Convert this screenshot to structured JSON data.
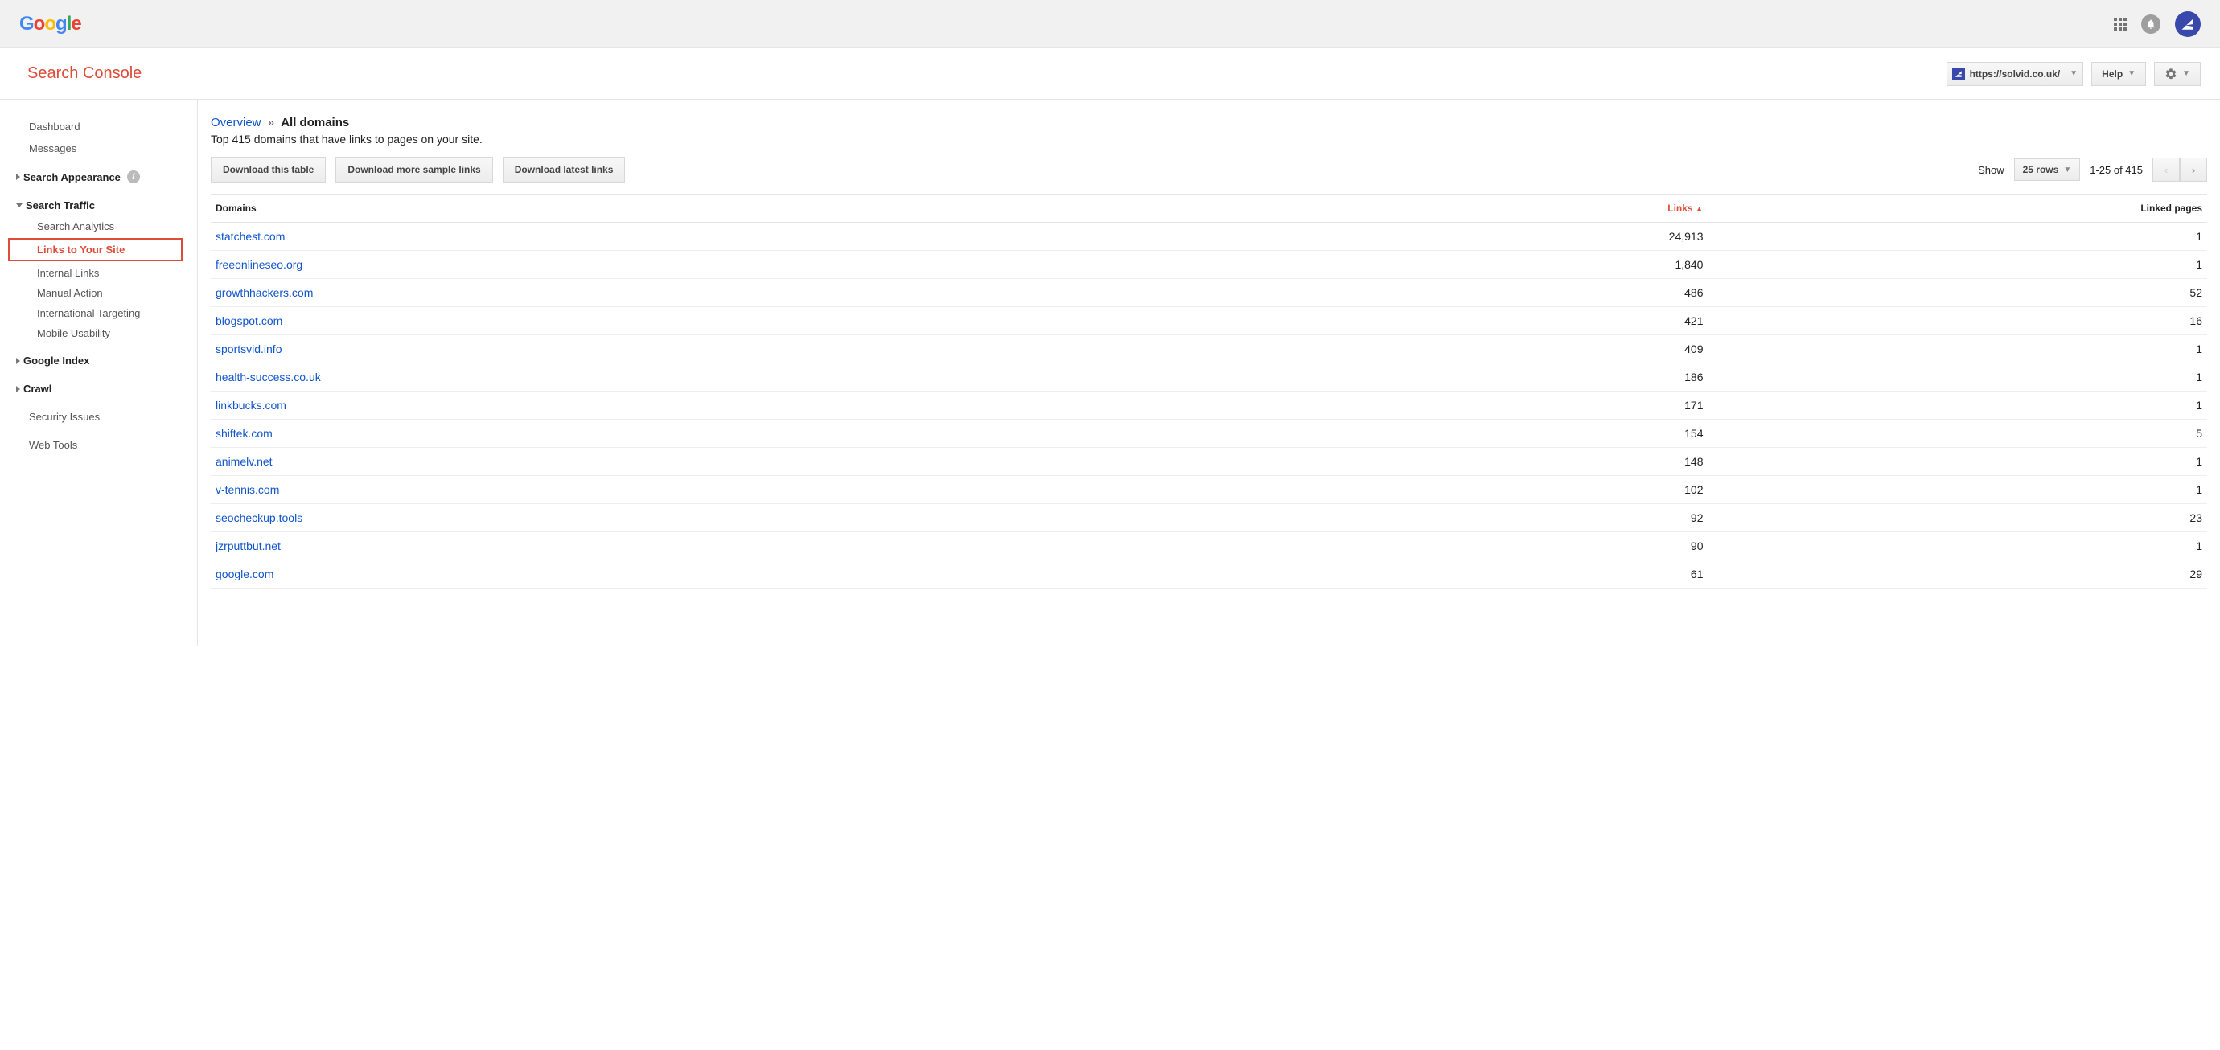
{
  "header": {
    "logo_text": "Google"
  },
  "subheader": {
    "title": "Search Console",
    "site_url": "https://solvid.co.uk/",
    "help_label": "Help"
  },
  "sidebar": {
    "dashboard": "Dashboard",
    "messages": "Messages",
    "search_appearance": "Search Appearance",
    "search_traffic": "Search Traffic",
    "children": {
      "analytics": "Search Analytics",
      "links_to_site": "Links to Your Site",
      "internal": "Internal Links",
      "manual": "Manual Action",
      "intl": "International Targeting",
      "mobile": "Mobile Usability"
    },
    "google_index": "Google Index",
    "crawl": "Crawl",
    "security": "Security Issues",
    "webtools": "Web Tools"
  },
  "main": {
    "bc_overview": "Overview",
    "bc_sep": "»",
    "bc_current": "All domains",
    "subtitle": "Top 415 domains that have links to pages on your site.",
    "dl_table": "Download this table",
    "dl_more": "Download more sample links",
    "dl_latest": "Download latest links",
    "show_label": "Show",
    "rows_selected": "25 rows",
    "range_text": "1-25 of 415",
    "th_domain": "Domains",
    "th_links": "Links",
    "th_pages": "Linked pages",
    "rows": [
      {
        "domain": "statchest.com",
        "links": "24,913",
        "pages": "1"
      },
      {
        "domain": "freeonlineseo.org",
        "links": "1,840",
        "pages": "1"
      },
      {
        "domain": "growthhackers.com",
        "links": "486",
        "pages": "52"
      },
      {
        "domain": "blogspot.com",
        "links": "421",
        "pages": "16"
      },
      {
        "domain": "sportsvid.info",
        "links": "409",
        "pages": "1"
      },
      {
        "domain": "health-success.co.uk",
        "links": "186",
        "pages": "1"
      },
      {
        "domain": "linkbucks.com",
        "links": "171",
        "pages": "1"
      },
      {
        "domain": "shiftek.com",
        "links": "154",
        "pages": "5"
      },
      {
        "domain": "animelv.net",
        "links": "148",
        "pages": "1"
      },
      {
        "domain": "v-tennis.com",
        "links": "102",
        "pages": "1"
      },
      {
        "domain": "seocheckup.tools",
        "links": "92",
        "pages": "23"
      },
      {
        "domain": "jzrputtbut.net",
        "links": "90",
        "pages": "1"
      },
      {
        "domain": "google.com",
        "links": "61",
        "pages": "29"
      }
    ]
  }
}
